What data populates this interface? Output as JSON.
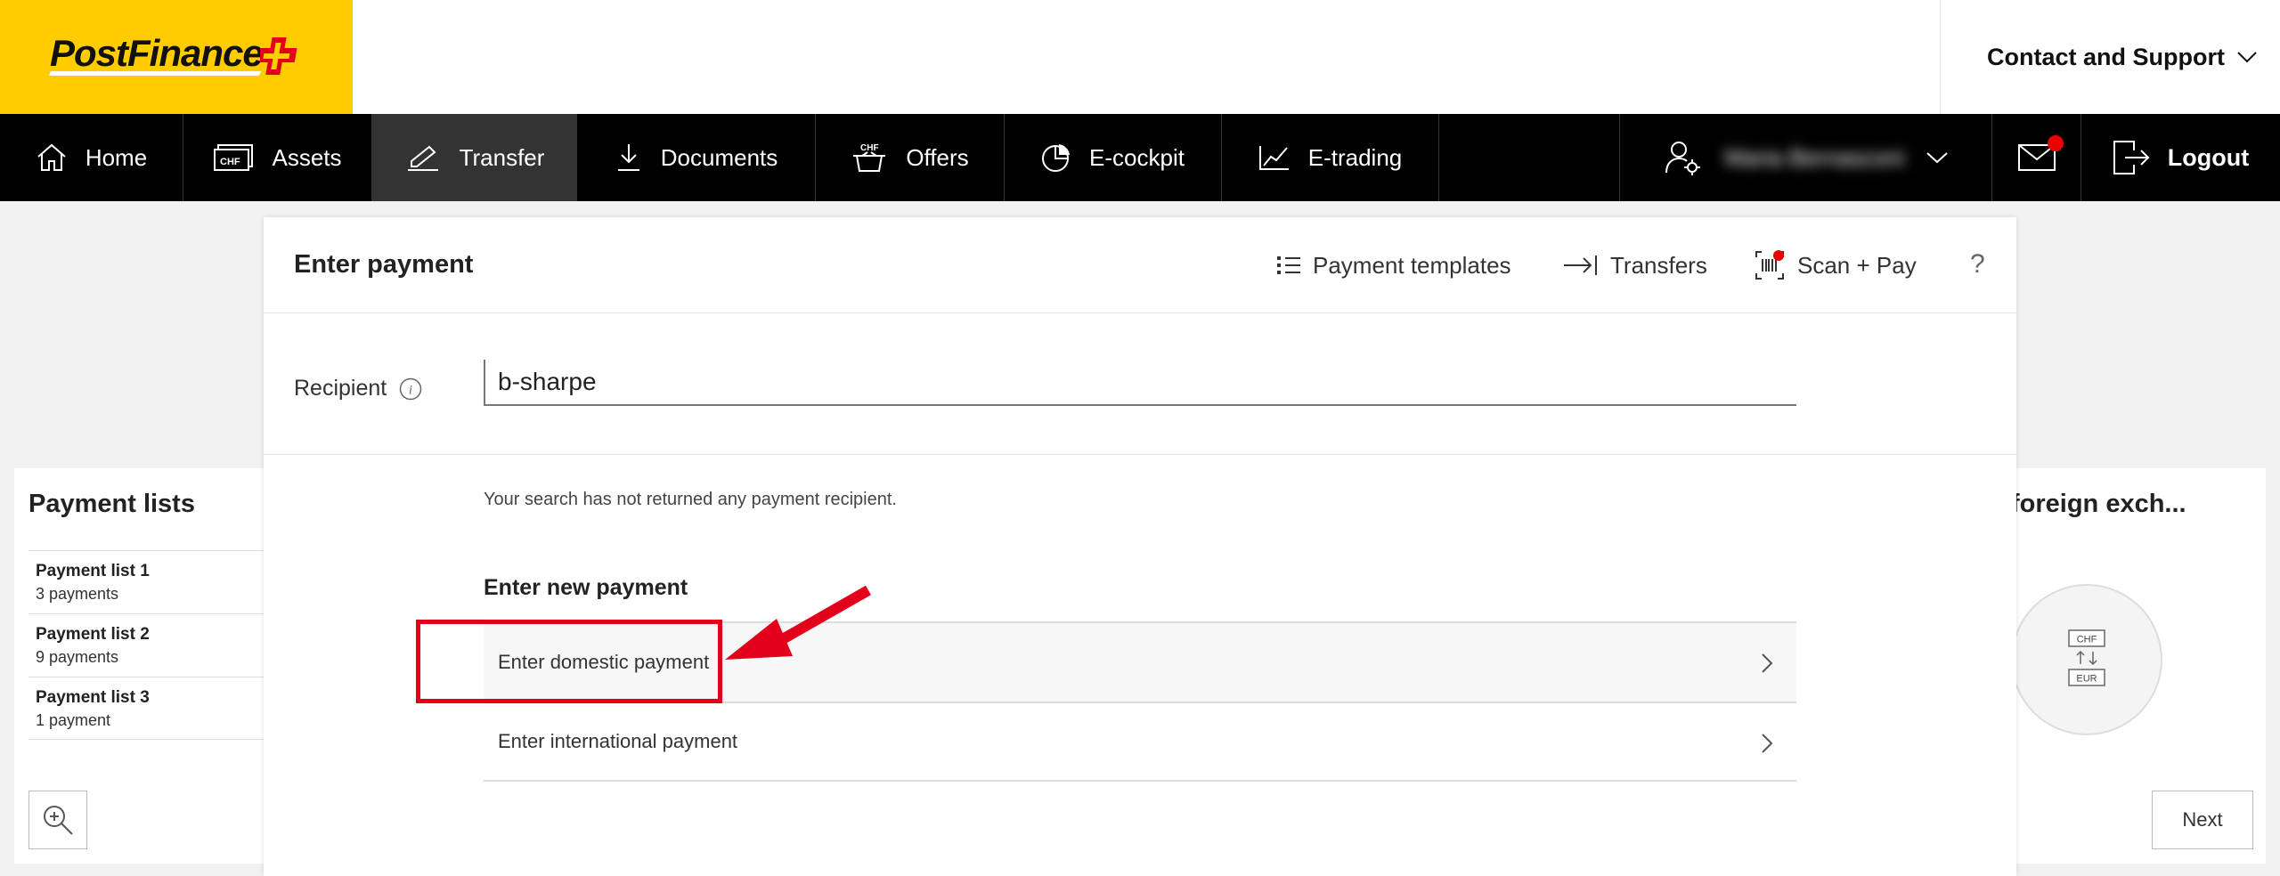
{
  "header": {
    "logo_text": "PostFinance",
    "contact_label": "Contact and Support"
  },
  "nav": {
    "items": [
      {
        "label": "Home",
        "icon": "home-icon"
      },
      {
        "label": "Assets",
        "icon": "chf-card-icon"
      },
      {
        "label": "Transfer",
        "icon": "transfer-pen-icon",
        "active": true
      },
      {
        "label": "Documents",
        "icon": "download-icon"
      },
      {
        "label": "Offers",
        "icon": "chf-basket-icon"
      },
      {
        "label": "E-cockpit",
        "icon": "pie-chart-icon"
      },
      {
        "label": "E-trading",
        "icon": "line-chart-icon"
      }
    ],
    "user_name": "Maria Bernasconi",
    "logout_label": "Logout"
  },
  "left_panel": {
    "title": "Payment lists",
    "lists": [
      {
        "title": "Payment list 1",
        "count": "3 payments"
      },
      {
        "title": "Payment list 2",
        "count": "9 payments"
      },
      {
        "title": "Payment list 3",
        "count": "1 payment"
      }
    ]
  },
  "right_panel": {
    "title": "foreign exch...",
    "fx_top": "CHF",
    "fx_bottom": "EUR",
    "next_label": "Next"
  },
  "card": {
    "title": "Enter payment",
    "actions": {
      "templates": "Payment templates",
      "transfers": "Transfers",
      "scan_pay": "Scan + Pay",
      "help": "?"
    },
    "recipient_label": "Recipient",
    "recipient_value": "b-sharpe",
    "no_result": "Your search has not returned any payment recipient.",
    "new_payment_title": "Enter new payment",
    "options": {
      "domestic": "Enter domestic payment",
      "international": "Enter international payment"
    }
  },
  "colors": {
    "brand_yellow": "#ffcc00",
    "nav_black": "#000000",
    "annotation_red": "#e3001b"
  }
}
